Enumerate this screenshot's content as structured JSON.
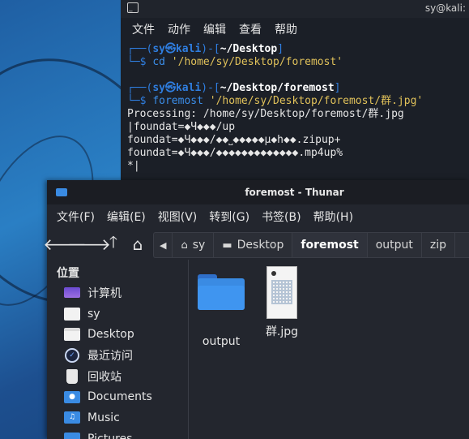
{
  "terminal": {
    "title": "sy@kali:",
    "menu": [
      "文件",
      "动作",
      "编辑",
      "查看",
      "帮助"
    ],
    "block1": {
      "prompt_open": "┌──(",
      "user": "sy㉿kali",
      "prompt_mid": ")-[",
      "dir": "~/Desktop",
      "prompt_close": "]",
      "line2_prefix": "└─$ ",
      "cmd": "cd",
      "arg": " '/home/sy/Desktop/foremost'"
    },
    "block2": {
      "prompt_open": "┌──(",
      "user": "sy㉿kali",
      "prompt_mid": ")-[",
      "dir": "~/Desktop/foremost",
      "prompt_close": "]",
      "line2_prefix": "└─$ ",
      "cmd": "foremost",
      "arg": " '/home/sy/Desktop/foremost/群.jpg'"
    },
    "output": [
      "Processing: /home/sy/Desktop/foremost/群.jpg",
      "|foundat=◆Ч◆◆◆/up",
      "foundat=◆Ч◆◆◆/◆◆˽◆◆◆◆◆µ◆h◆◆.zipup+",
      "foundat=◆Ч◆◆◆/◆◆◆◆◆◆◆◆◆◆◆◆◆.mp4up%",
      "*|"
    ]
  },
  "thunar": {
    "title": "foremost - Thunar",
    "menu": [
      "文件(F)",
      "编辑(E)",
      "视图(V)",
      "转到(G)",
      "书签(B)",
      "帮助(H)"
    ],
    "breadcrumbs": [
      "sy",
      "Desktop",
      "foremost",
      "output",
      "zip"
    ],
    "sidebar_heading": "位置",
    "sidebar_items": [
      "计算机",
      "sy",
      "Desktop",
      "最近访问",
      "回收站",
      "Documents",
      "Music",
      "Pictures"
    ],
    "files": [
      {
        "name": "output",
        "icon": "folder-icon"
      },
      {
        "name": "群.jpg",
        "icon": "image-thumbnail"
      }
    ]
  }
}
